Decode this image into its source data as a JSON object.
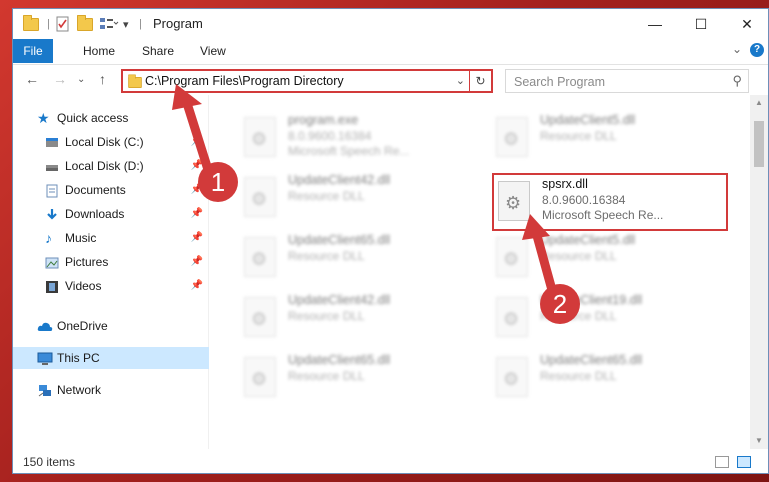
{
  "window": {
    "title": "Program",
    "minimize": "—",
    "maximize": "☐",
    "close": "✕"
  },
  "ribbon": {
    "tabs": [
      "File",
      "Home",
      "Share",
      "View"
    ],
    "expand": "⌄",
    "help": "?"
  },
  "address": {
    "path": "C:\\Program Files\\Program Directory",
    "dropdown": "⌄",
    "refresh": "↻"
  },
  "search": {
    "placeholder": "Search Program",
    "icon": "⚲"
  },
  "nav": {
    "back": "←",
    "forward": "→",
    "recent": "⌄",
    "up": "↑",
    "items": [
      {
        "label": "Quick access",
        "icon": "star-icon",
        "pinned": false
      },
      {
        "label": "Local Disk (C:)",
        "icon": "drive-icon",
        "pinned": true
      },
      {
        "label": "Local Disk (D:)",
        "icon": "drive-icon",
        "pinned": true
      },
      {
        "label": "Documents",
        "icon": "documents-icon",
        "pinned": true
      },
      {
        "label": "Downloads",
        "icon": "downloads-icon",
        "pinned": true
      },
      {
        "label": "Music",
        "icon": "music-icon",
        "pinned": true
      },
      {
        "label": "Pictures",
        "icon": "pictures-icon",
        "pinned": true
      },
      {
        "label": "Videos",
        "icon": "videos-icon",
        "pinned": true
      },
      {
        "label": "OneDrive",
        "icon": "cloud-icon",
        "pinned": false
      },
      {
        "label": "This PC",
        "icon": "computer-icon",
        "pinned": false,
        "selected": true
      },
      {
        "label": "Network",
        "icon": "network-icon",
        "pinned": false
      }
    ]
  },
  "files": [
    {
      "name": "program.exe",
      "line2": "8.0.9600.16384",
      "line3": "Microsoft Speech Re...",
      "blurred": true
    },
    {
      "name": "UpdateClient5.dll",
      "line2": "Resource DLL",
      "line3": "",
      "blurred": true
    },
    {
      "name": "UpdateClient42.dll",
      "line2": "Resource DLL",
      "line3": "",
      "blurred": true
    },
    {
      "name": "spsrx.dll",
      "line2": "8.0.9600.16384",
      "line3": "Microsoft Speech Re...",
      "blurred": false
    },
    {
      "name": "UpdateClient65.dll",
      "line2": "Resource DLL",
      "line3": "",
      "blurred": true
    },
    {
      "name": "UpdateClient5.dll",
      "line2": "Resource DLL",
      "line3": "",
      "blurred": true
    },
    {
      "name": "UpdateClient42.dll",
      "line2": "Resource DLL",
      "line3": "",
      "blurred": true
    },
    {
      "name": "UpdateClient19.dll",
      "line2": "Resource DLL",
      "line3": "",
      "blurred": true
    },
    {
      "name": "UpdateClient65.dll",
      "line2": "Resource DLL",
      "line3": "",
      "blurred": true
    },
    {
      "name": "UpdateClient65.dll",
      "line2": "Resource DLL",
      "line3": "",
      "blurred": true
    }
  ],
  "status": {
    "count": "150 items"
  },
  "annotations": {
    "step1": "1",
    "step2": "2",
    "color": "#d23a3a"
  },
  "colors": {
    "accent": "#1979ca",
    "selected": "#cce8ff",
    "annotation": "#d23a3a"
  }
}
